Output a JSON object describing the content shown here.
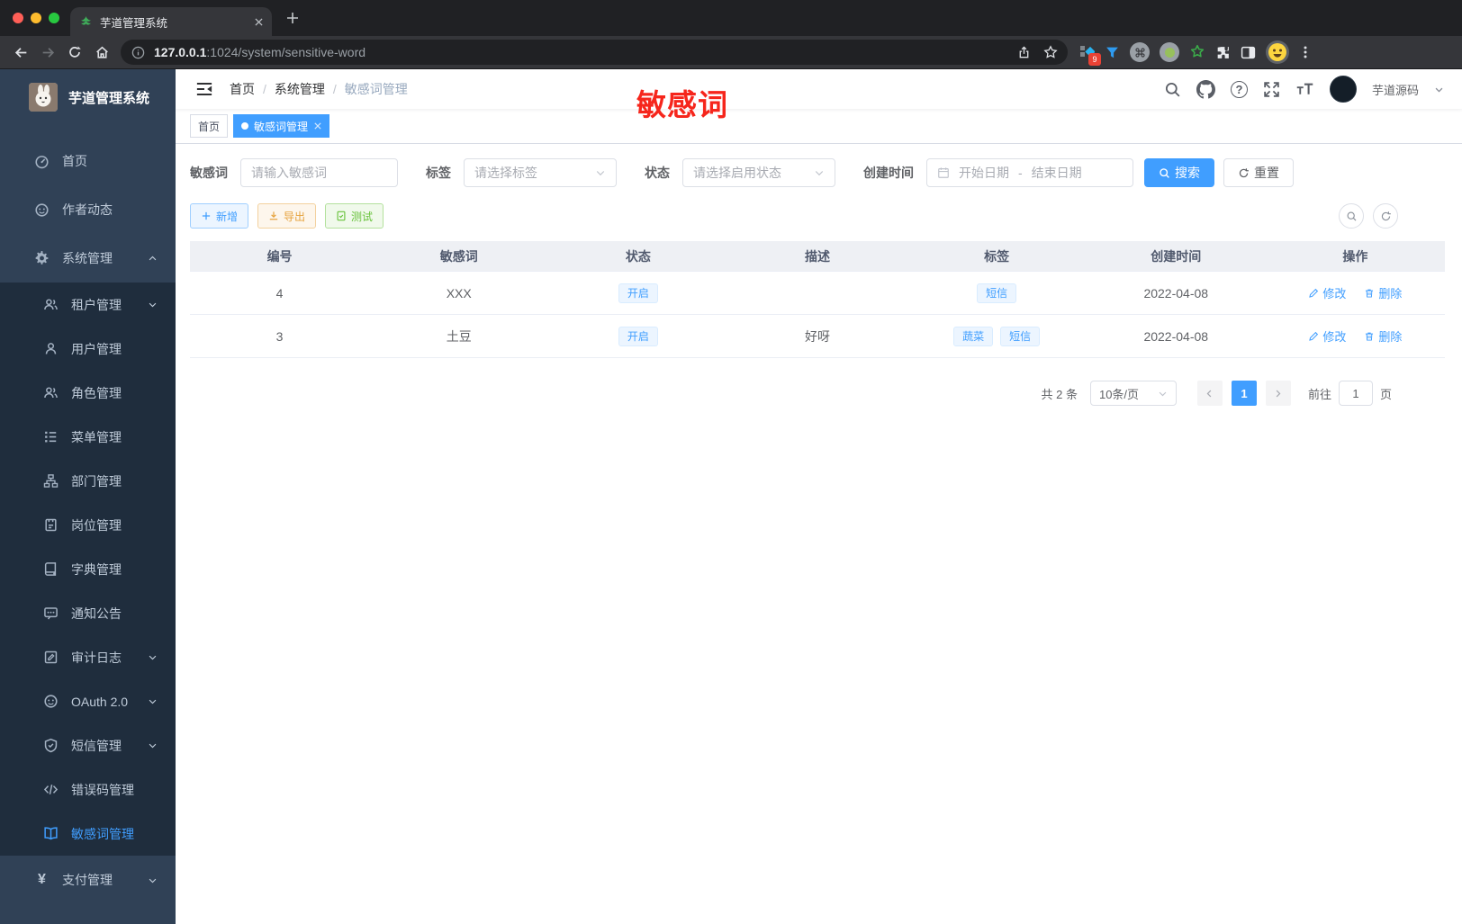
{
  "browser": {
    "tab_title": "芋道管理系统",
    "url": {
      "host": "127.0.0.1",
      "path": ":1024/system/sensitive-word"
    },
    "extension_badge": "9"
  },
  "icons": {
    "question": "?",
    "yen": "¥"
  },
  "sidebar": {
    "title": "芋道管理系统",
    "items": [
      {
        "label": "首页",
        "icon": "dashboard-icon"
      },
      {
        "label": "作者动态",
        "icon": "author-icon"
      },
      {
        "label": "系统管理",
        "icon": "gear-icon",
        "expanded": true
      },
      {
        "label": "租户管理",
        "icon": "tenant-icon",
        "collapsible": true
      },
      {
        "label": "用户管理",
        "icon": "user-icon"
      },
      {
        "label": "角色管理",
        "icon": "role-icon"
      },
      {
        "label": "菜单管理",
        "icon": "menu-tree-icon"
      },
      {
        "label": "部门管理",
        "icon": "org-icon"
      },
      {
        "label": "岗位管理",
        "icon": "post-icon"
      },
      {
        "label": "字典管理",
        "icon": "dict-icon"
      },
      {
        "label": "通知公告",
        "icon": "notice-icon"
      },
      {
        "label": "审计日志",
        "icon": "audit-log-icon",
        "collapsible": true
      },
      {
        "label": "OAuth 2.0",
        "icon": "oauth-icon",
        "collapsible": true
      },
      {
        "label": "短信管理",
        "icon": "sms-shield-icon",
        "collapsible": true
      },
      {
        "label": "错误码管理",
        "icon": "code-icon"
      },
      {
        "label": "敏感词管理",
        "icon": "open-book-icon",
        "active": true
      },
      {
        "label": "支付管理",
        "icon": "yen-icon",
        "collapsible": true
      }
    ]
  },
  "header": {
    "breadcrumb": {
      "items": [
        "首页",
        "系统管理",
        "敏感词管理"
      ],
      "separator": "/"
    },
    "user_name": "芋道源码",
    "annotation": "敏感词"
  },
  "tags_view": {
    "tabs": [
      {
        "label": "首页",
        "active": false
      },
      {
        "label": "敏感词管理",
        "active": true
      }
    ]
  },
  "filters": {
    "keyword": {
      "label": "敏感词",
      "placeholder": "请输入敏感词"
    },
    "tag": {
      "label": "标签",
      "placeholder": "请选择标签"
    },
    "status": {
      "label": "状态",
      "placeholder": "请选择启用状态"
    },
    "create_time": {
      "label": "创建时间",
      "start_placeholder": "开始日期",
      "separator": "-",
      "end_placeholder": "结束日期"
    },
    "search_label": "搜索",
    "reset_label": "重置"
  },
  "toolbar": {
    "add_label": "新增",
    "export_label": "导出",
    "test_label": "测试"
  },
  "table": {
    "columns": [
      "编号",
      "敏感词",
      "状态",
      "描述",
      "标签",
      "创建时间",
      "操作"
    ],
    "rows": [
      {
        "id": "4",
        "word": "XXX",
        "status": "开启",
        "description": "",
        "tags": [
          "短信"
        ],
        "created": "2022-04-08",
        "edit_label": "修改",
        "delete_label": "删除"
      },
      {
        "id": "3",
        "word": "土豆",
        "status": "开启",
        "description": "好呀",
        "tags": [
          "蔬菜",
          "短信"
        ],
        "created": "2022-04-08",
        "edit_label": "修改",
        "delete_label": "删除"
      }
    ]
  },
  "pagination": {
    "total": "共 2 条",
    "page_size": "10条/页",
    "current_page": "1",
    "goto_label": "前往",
    "goto_value": "1",
    "page_unit": "页"
  },
  "colors": {
    "primary": "#409eff",
    "success": "#67c23a",
    "warning": "#e6a23c",
    "annotation_red": "#f6261c",
    "sidebar_bg": "#304156",
    "submenu_bg": "#1f2d3d"
  }
}
